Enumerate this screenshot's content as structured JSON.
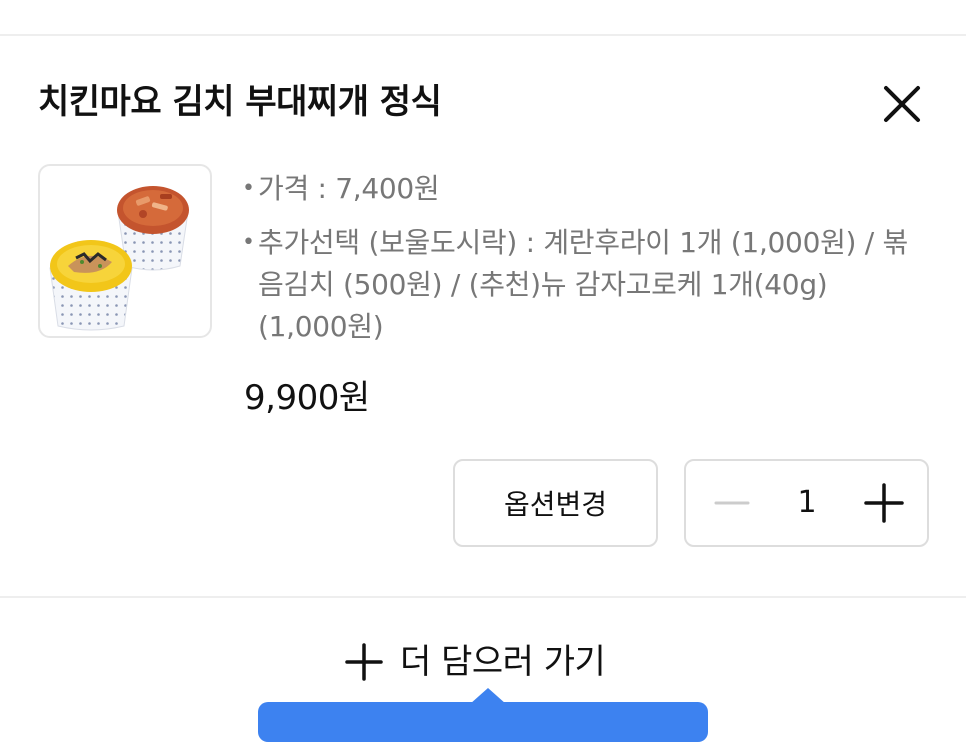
{
  "item": {
    "title": "치킨마요 김치 부대찌개 정식",
    "image_alt": "치킨마요 김치 부대찌개 정식",
    "details": [
      {
        "bullet": "•",
        "text": "가격 : 7,400원"
      },
      {
        "bullet": "•",
        "text": "추가선택 (보울도시락) : 계란후라이 1개 (1,000원) / 볶음김치 (500원) / (추천)뉴 감자고로케 1개(40g) (1,000원)"
      }
    ],
    "total_price": "9,900원"
  },
  "actions": {
    "option_change_label": "옵션변경",
    "quantity": "1"
  },
  "footer": {
    "add_more_label": "더 담으러 가기"
  },
  "colors": {
    "accent_blue": "#3d82f0",
    "muted_text": "#777777",
    "border": "#dddddd"
  },
  "icons": {
    "close": "close-icon",
    "minus": "minus-icon",
    "plus": "plus-icon"
  }
}
